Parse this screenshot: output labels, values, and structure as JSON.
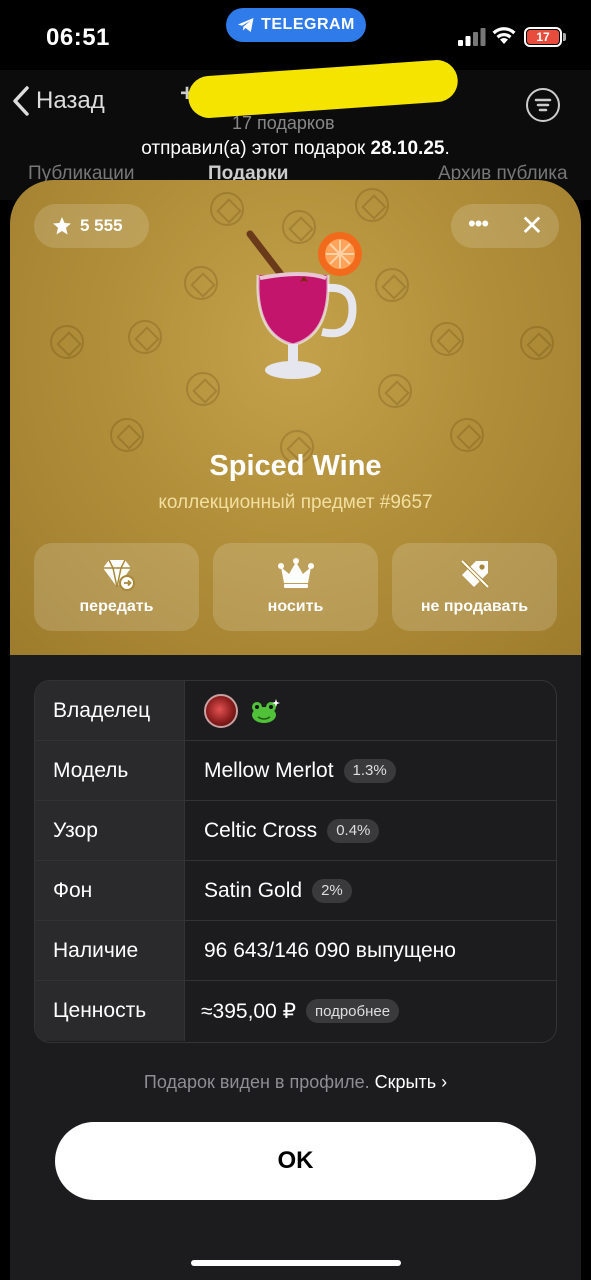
{
  "status_bar": {
    "time": "06:51",
    "app_pill": "TELEGRAM",
    "battery": "17"
  },
  "header": {
    "back_label": "Назад",
    "phone_prefix": "+7",
    "gifts_count": "17 подарков",
    "sent_text": "отправил(а) этот подарок ",
    "sent_date": "28.10.25",
    "sent_suffix": "."
  },
  "tabs": [
    "Публикации",
    "Подарки",
    "Архив публика"
  ],
  "sheet": {
    "stars": "5 555",
    "gift_name": "Spiced Wine",
    "gift_subtitle": "коллекционный предмет #9657",
    "actions": [
      {
        "label": "передать",
        "icon": "transfer-gem-icon"
      },
      {
        "label": "носить",
        "icon": "crown-icon"
      },
      {
        "label": "не продавать",
        "icon": "unlist-tag-icon"
      }
    ],
    "table": [
      {
        "label": "Владелец",
        "value": "",
        "badge": ""
      },
      {
        "label": "Модель",
        "value": "Mellow Merlot",
        "badge": "1.3%"
      },
      {
        "label": "Узор",
        "value": "Celtic Cross",
        "badge": "0.4%"
      },
      {
        "label": "Фон",
        "value": "Satin Gold",
        "badge": "2%"
      },
      {
        "label": "Наличие",
        "value": "96 643/146 090 выпущено",
        "badge": ""
      },
      {
        "label": "Ценность",
        "value": "≈395,00 ₽",
        "badge": "подробнее"
      }
    ],
    "visibility_note": "Подарок виден в профиле. ",
    "hide_link": "Скрыть",
    "ok_label": "OK"
  },
  "colors": {
    "hero_gold": "#b28f3a",
    "telegram_blue": "#2f7bea",
    "battery_red": "#e74c3c",
    "sheet_bg": "#1c1c1e"
  }
}
